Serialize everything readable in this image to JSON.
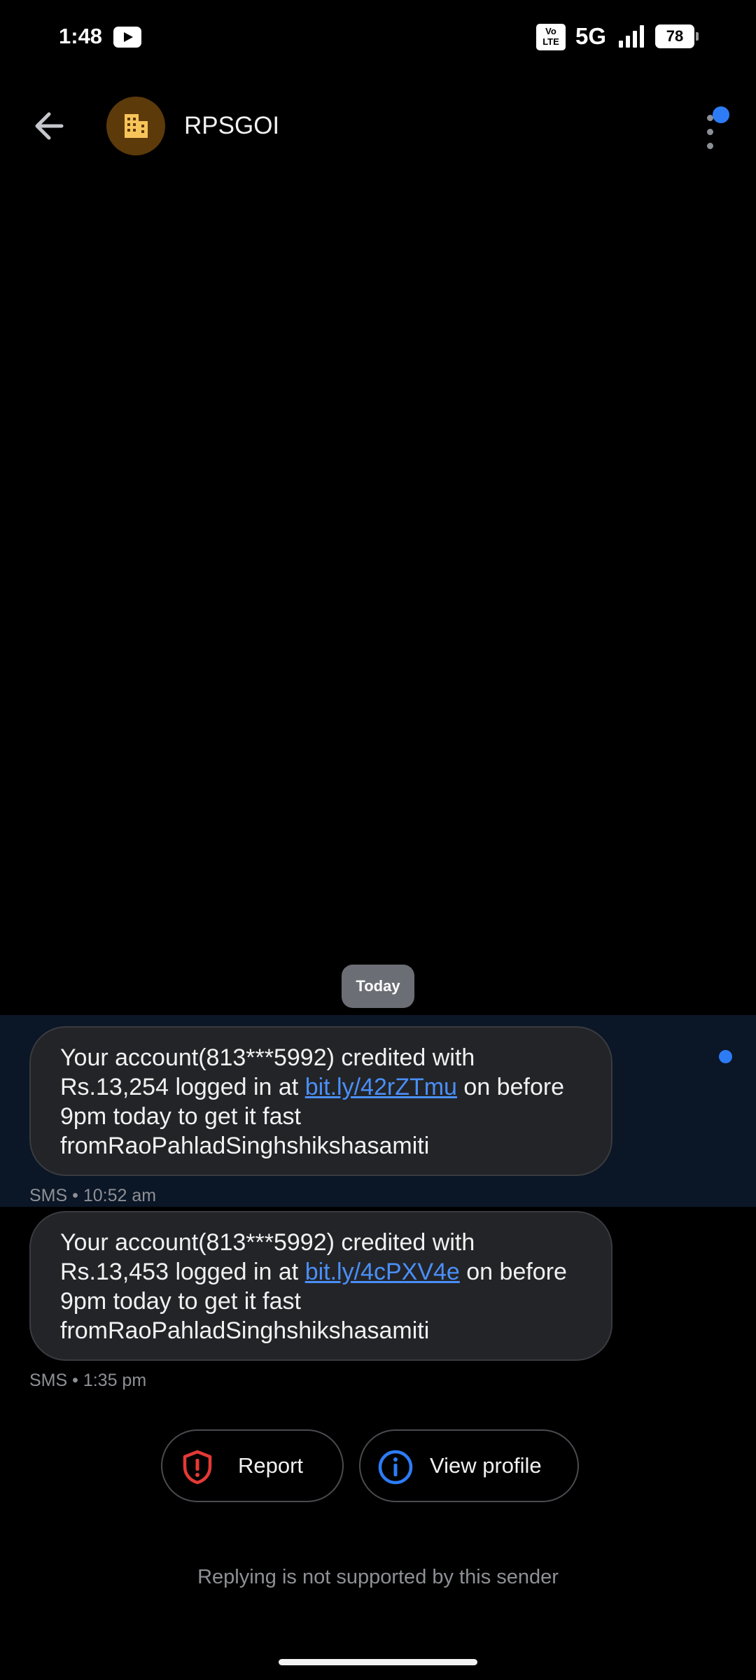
{
  "status_bar": {
    "time": "1:48",
    "volte_label": "Vo LTE",
    "network": "5G",
    "battery": "78",
    "icons": [
      "youtube-icon",
      "volte-icon",
      "signal-icon",
      "battery-icon"
    ]
  },
  "header": {
    "sender": "RPSGOI",
    "avatar_icon": "building-icon",
    "back_icon": "arrow-left-icon",
    "menu_icon": "more-vert-icon"
  },
  "conversation": {
    "date_divider": "Today",
    "messages": [
      {
        "text_before": "Your account(813***5992) credited with Rs.13,254 logged in at ",
        "link": "bit.ly/42rZTmu",
        "text_after": " on before 9pm today to get it fast fromRaoPahladSinghshikshasamiti",
        "meta": "SMS • 10:52 am",
        "highlighted": true
      },
      {
        "text_before": "Your account(813***5992) credited with Rs.13,453 logged in at ",
        "link": "bit.ly/4cPXV4e",
        "text_after": " on before 9pm today to get it fast fromRaoPahladSinghshikshasamiti",
        "meta": "SMS • 1:35 pm",
        "highlighted": false
      }
    ]
  },
  "actions": {
    "report_label": "Report",
    "view_profile_label": "View profile"
  },
  "footer": {
    "reply_note": "Replying is not supported by this sender"
  },
  "colors": {
    "accent": "#2d7cf6",
    "link": "#4a8ff7",
    "report": "#e53935",
    "bubble": "#232428",
    "highlight": "#0b1626"
  }
}
